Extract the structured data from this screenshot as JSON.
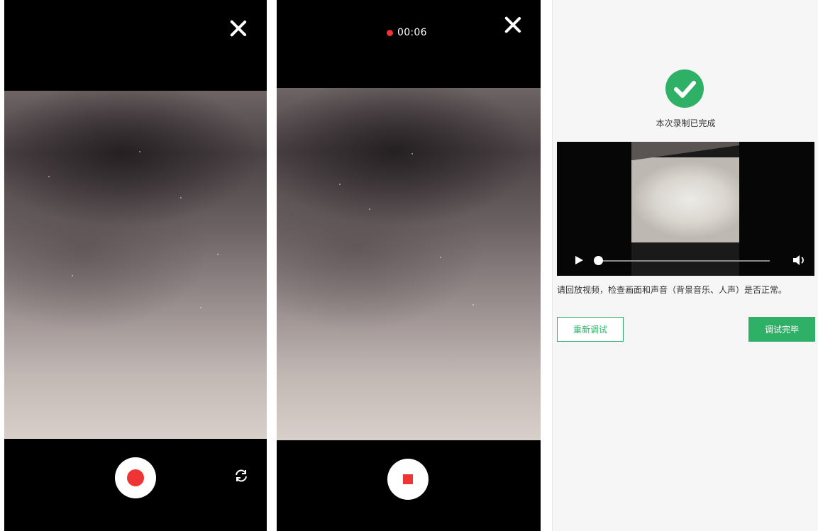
{
  "recording": {
    "timer": "00:06"
  },
  "result": {
    "status_text": "本次录制已完成",
    "instruction": "请回放视频，检查画面和声音（背景音乐、人声）是否正常。",
    "retry_label": "重新调试",
    "done_label": "调试完毕"
  },
  "icons": {
    "close": "close-icon",
    "record": "record-icon",
    "stop": "stop-icon",
    "switch_camera": "switch-camera-icon",
    "check": "check-circle-icon",
    "play": "play-icon",
    "volume": "volume-icon"
  },
  "player": {
    "progress": 0
  },
  "colors": {
    "record_red": "#ef3434",
    "accent_green": "#2eb067",
    "camera_bg": "#000000",
    "page_bg": "#f6f6f6"
  }
}
